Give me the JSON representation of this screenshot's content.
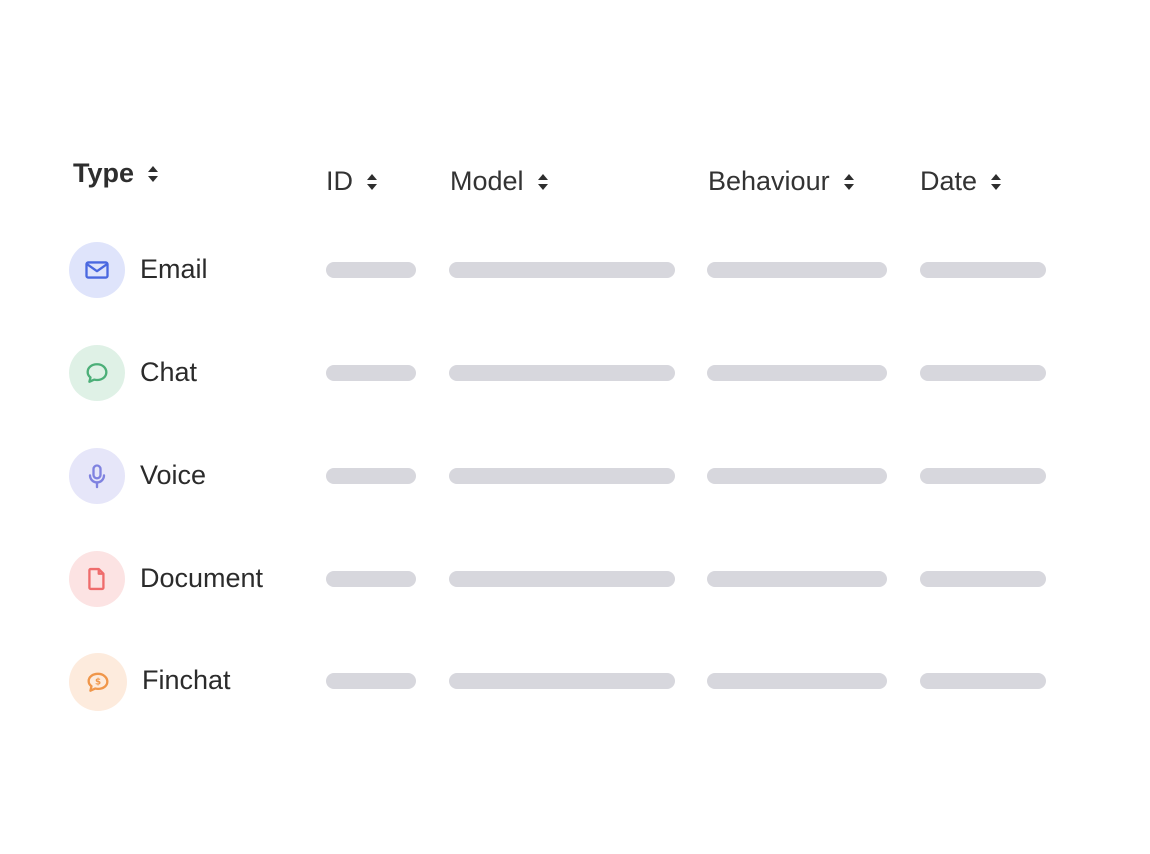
{
  "table": {
    "columns": [
      {
        "key": "type",
        "label": "Type",
        "sort_icon": "sort-icon"
      },
      {
        "key": "id",
        "label": "ID",
        "sort_icon": "sort-icon"
      },
      {
        "key": "model",
        "label": "Model",
        "sort_icon": "sort-icon"
      },
      {
        "key": "behaviour",
        "label": "Behaviour",
        "sort_icon": "sort-icon"
      },
      {
        "key": "date",
        "label": "Date",
        "sort_icon": "sort-icon"
      }
    ],
    "rows": [
      {
        "type": "Email",
        "icon": "mail-icon",
        "icon_color": "#4a68e0",
        "badge_color": "#dfe4fb",
        "placeholder": true
      },
      {
        "type": "Chat",
        "icon": "chat-bubble-icon",
        "icon_color": "#4caf78",
        "badge_color": "#dff1e6",
        "placeholder": true
      },
      {
        "type": "Voice",
        "icon": "microphone-icon",
        "icon_color": "#7f82e0",
        "badge_color": "#e6e6f9",
        "placeholder": true
      },
      {
        "type": "Document",
        "icon": "document-icon",
        "icon_color": "#ef6c6c",
        "badge_color": "#fce3e3",
        "placeholder": true
      },
      {
        "type": "Finchat",
        "icon": "dollar-chat-icon",
        "icon_color": "#f0964a",
        "badge_color": "#fdebdd",
        "placeholder": true
      }
    ]
  },
  "colors": {
    "placeholder_bar": "#d7d7dd",
    "header_text": "#333333"
  }
}
